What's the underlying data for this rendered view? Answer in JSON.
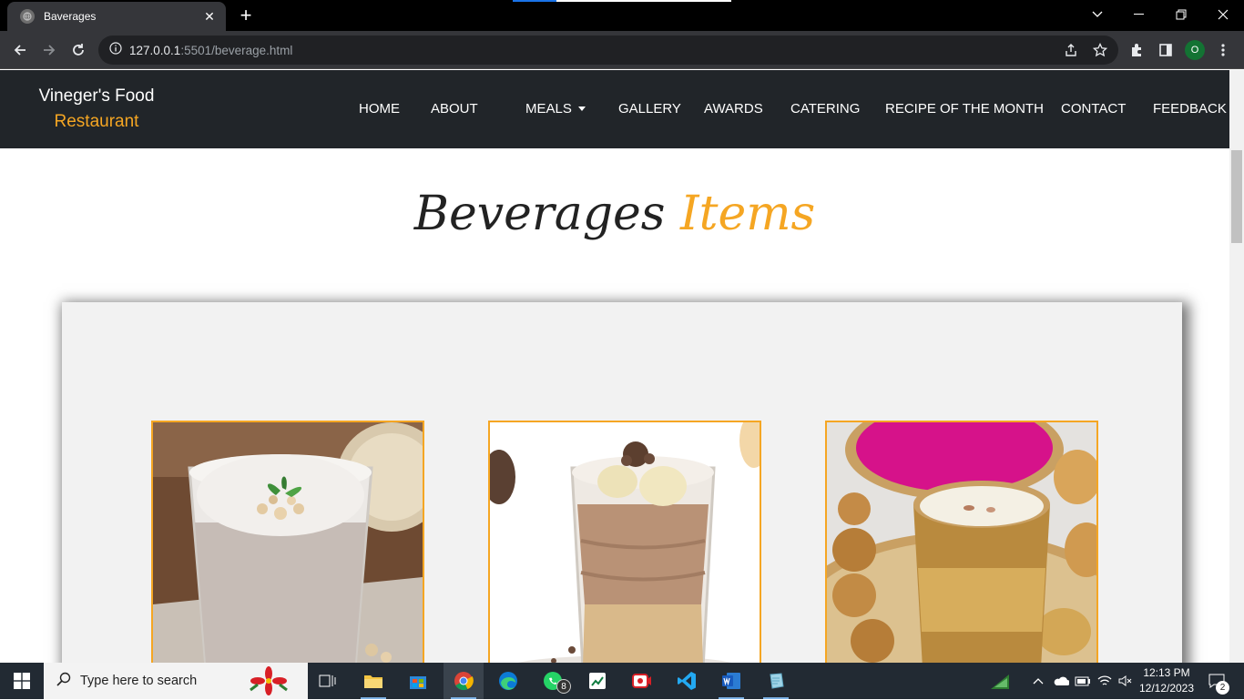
{
  "browser": {
    "tab_title": "Baverages",
    "url_host": "127.0.0.1",
    "url_rest": ":5501/beverage.html",
    "profile_initial": "O"
  },
  "site": {
    "brand_name": "Vineger's Food",
    "brand_sub": "Restaurant",
    "menu": [
      "HOME",
      "ABOUT",
      "MEALS",
      "GALLERY",
      "AWARDS",
      "CATERING",
      "RECIPE OF THE MONTH",
      "CONTACT",
      "FEEDBACK"
    ],
    "heading_main": "Beverages",
    "heading_accent": "Items"
  },
  "cards": [
    {
      "alt": "oat milk drink in glass"
    },
    {
      "alt": "chocolate banana shake in glass"
    },
    {
      "alt": "thandai in brass glass with pink powder and sweets"
    }
  ],
  "colors": {
    "accent": "#f5a623",
    "nav_bg": "#212529",
    "panel_bg": "#f2f2f2"
  },
  "taskbar": {
    "search_placeholder": "Type here to search",
    "whatsapp_badge": "8",
    "time": "12:13 PM",
    "date": "12/12/2023",
    "notifications": "2"
  }
}
